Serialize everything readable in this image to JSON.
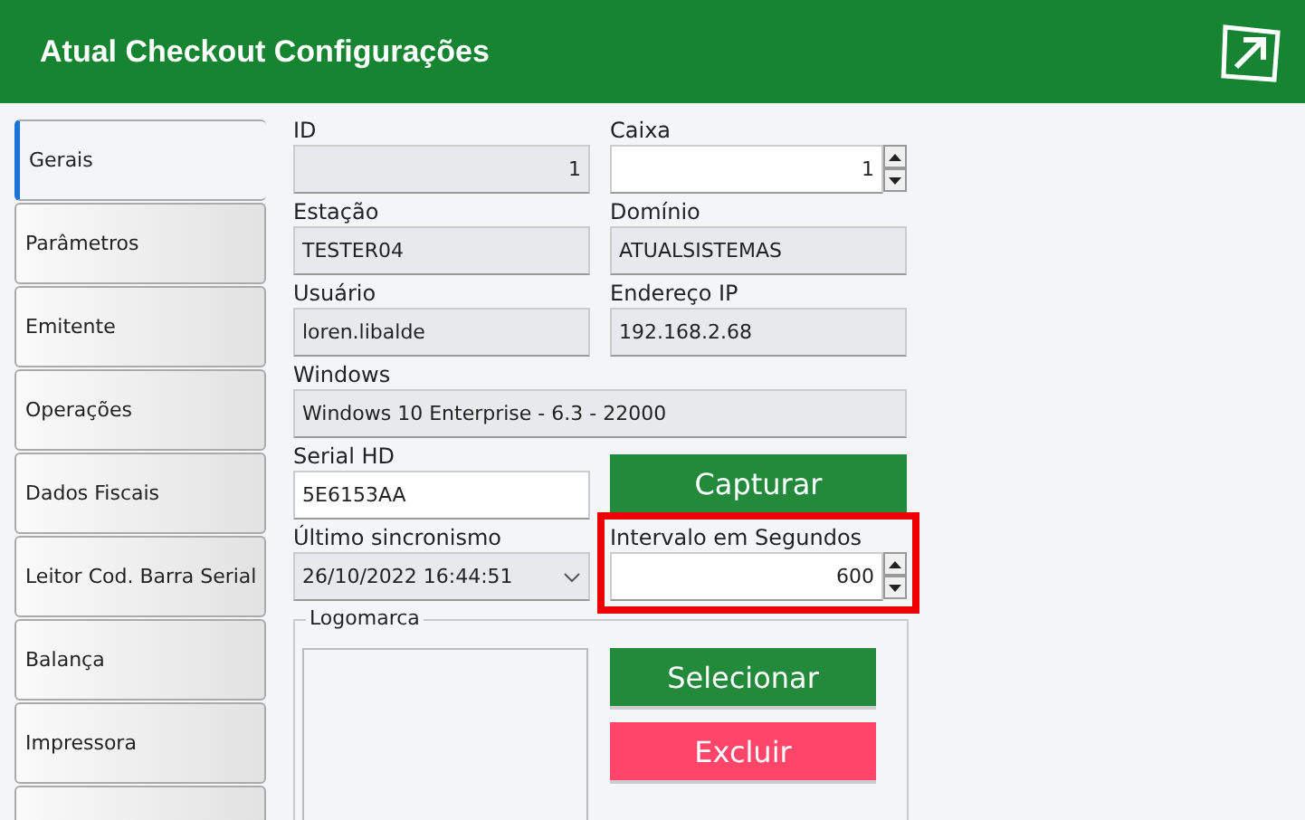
{
  "window": {
    "title": "Atual Checkout Configurações"
  },
  "tabs": [
    {
      "label": "Gerais",
      "selected": true
    },
    {
      "label": "Parâmetros",
      "selected": false
    },
    {
      "label": "Emitente",
      "selected": false
    },
    {
      "label": "Operações",
      "selected": false
    },
    {
      "label": "Dados Fiscais",
      "selected": false
    },
    {
      "label": "Leitor Cod. Barra Serial",
      "selected": false
    },
    {
      "label": "Balança",
      "selected": false
    },
    {
      "label": "Impressora",
      "selected": false
    },
    {
      "selected": false
    }
  ],
  "fields": [
    {
      "label": "ID",
      "value": "1",
      "kind": "number"
    },
    {
      "label": "Caixa",
      "value": "1",
      "kind": "spin"
    },
    {
      "label": "Estação",
      "value": "TESTER04",
      "kind": "readonly"
    },
    {
      "label": "Domínio",
      "value": "ATUALSISTEMAS",
      "kind": "readonly"
    },
    {
      "label": "Usuário",
      "value": "loren.libalde",
      "kind": "readonly"
    },
    {
      "label": "Endereço IP",
      "value": "192.168.2.68",
      "kind": "readonly"
    },
    {
      "label": "Windows",
      "value": "Windows 10 Enterprise - 6.3 - 22000",
      "kind": "readonly",
      "wide": true
    },
    {
      "label": "Serial HD",
      "value": "5E6153AA",
      "kind": "text"
    },
    {
      "label": "Capturar",
      "kind": "button"
    },
    {
      "label": "Último sincronismo",
      "value": "26/10/2022 16:44:51",
      "kind": "dropdown"
    },
    {
      "label": "Intervalo em Segundos",
      "value": "600",
      "kind": "spin",
      "highlighted": true
    }
  ],
  "logo_group": {
    "title": "Logomarca",
    "buttons": [
      {
        "label": "Selecionar",
        "kind": "primary"
      },
      {
        "label": "Excluir",
        "kind": "danger"
      }
    ]
  }
}
